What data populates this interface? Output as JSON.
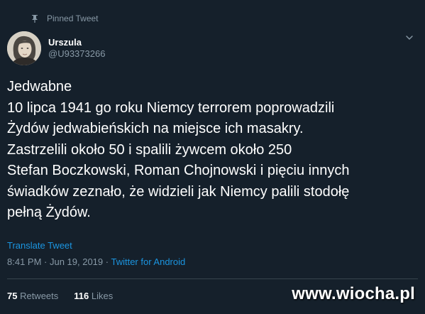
{
  "pinned": {
    "label": "Pinned Tweet",
    "icon": "pin-icon"
  },
  "user": {
    "name": "Urszula",
    "handle": "@U93373266",
    "avatar_icon": "avatar"
  },
  "header": {
    "menu_icon": "chevron-down-icon"
  },
  "tweet": {
    "lines": [
      "Jedwabne",
      "10 lipca 1941 go roku Niemcy terrorem poprowadzili",
      "Żydów jedwabieńskich na miejsce ich masakry.",
      "Zastrzelili około 50 i spalili żywcem około 250",
      "Stefan Boczkowski, Roman Chojnowski i pięciu innych",
      "świadków zeznało, że widzieli jak Niemcy palili stodołę",
      "pełną Żydów."
    ],
    "translate_label": "Translate Tweet",
    "timestamp": "8:41 PM · Jun 19, 2019 · ",
    "source": "Twitter for Android"
  },
  "stats": {
    "retweets_count": "75",
    "retweets_label": " Retweets",
    "likes_count": "116",
    "likes_label": " Likes"
  },
  "watermark": "www.wiocha.pl",
  "colors": {
    "background": "#15202b",
    "text": "#ffffff",
    "secondary": "#8899a6",
    "link": "#1b95e0",
    "divider": "#38444d"
  }
}
